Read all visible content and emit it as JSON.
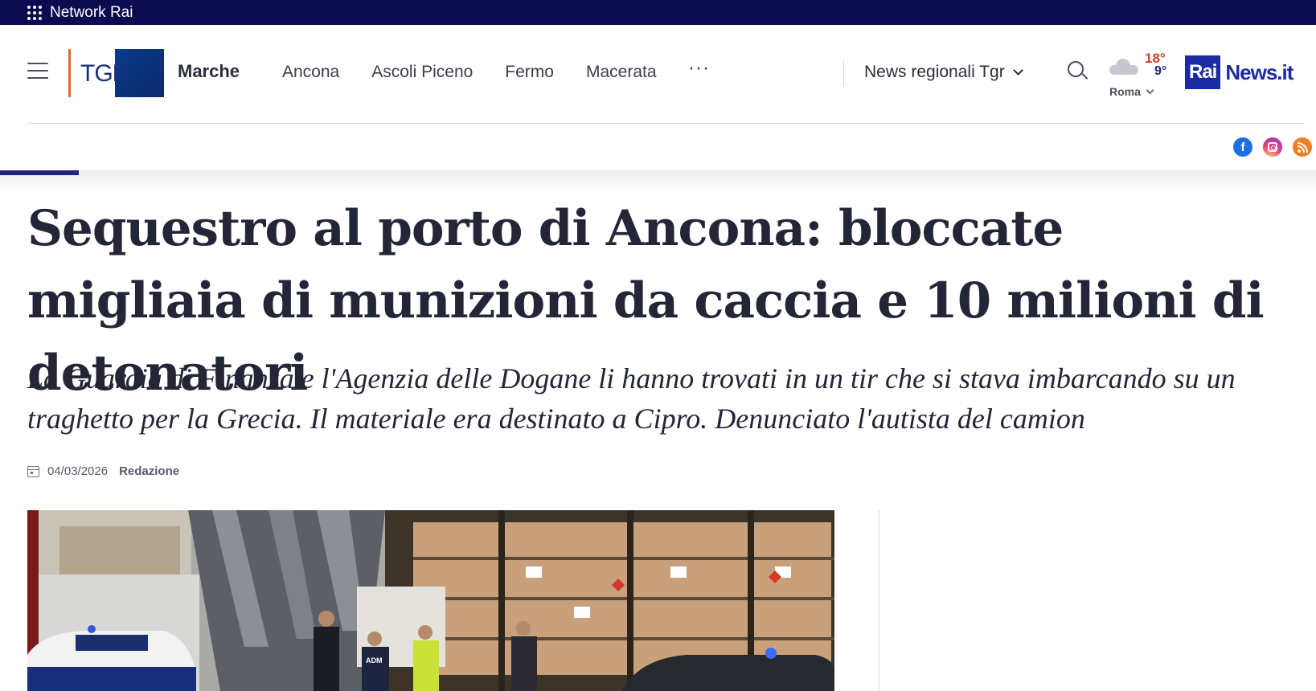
{
  "network_bar": {
    "label": "Network Rai"
  },
  "header": {
    "logo_text": "TGR",
    "region": "Marche",
    "nav": [
      "Ancona",
      "Ascoli Piceno",
      "Fermo",
      "Macerata"
    ],
    "more": "···",
    "news_dropdown": "News regionali Tgr",
    "weather": {
      "max": "18°",
      "min": "9°",
      "city": "Roma",
      "icon": "cloud-icon"
    },
    "brand": {
      "rai": "Rai",
      "news": "News.it"
    }
  },
  "social": [
    "facebook-icon",
    "instagram-icon",
    "rss-icon"
  ],
  "reading_progress": 0.06,
  "article": {
    "headline": "Sequestro al porto di Ancona: bloccate migliaia di munizioni da caccia e 10 milioni di detonatori",
    "subtitle": "La Guardia di Finanza e l'Agenzia delle Dogane li hanno trovati in un tir che si stava imbarcando su un traghetto per la Grecia. Il materiale era destinato a Cipro. Denunciato l'autista del camion",
    "date": "04/03/2026",
    "author": "Redazione",
    "image_labels": {
      "van": "ADM"
    }
  },
  "colors": {
    "network_bar": "#0d0b4f",
    "brand_blue": "#1c2ba3",
    "accent_orange": "#e86a2c",
    "temp_max": "#d63a2b",
    "temp_min": "#1c2480"
  }
}
